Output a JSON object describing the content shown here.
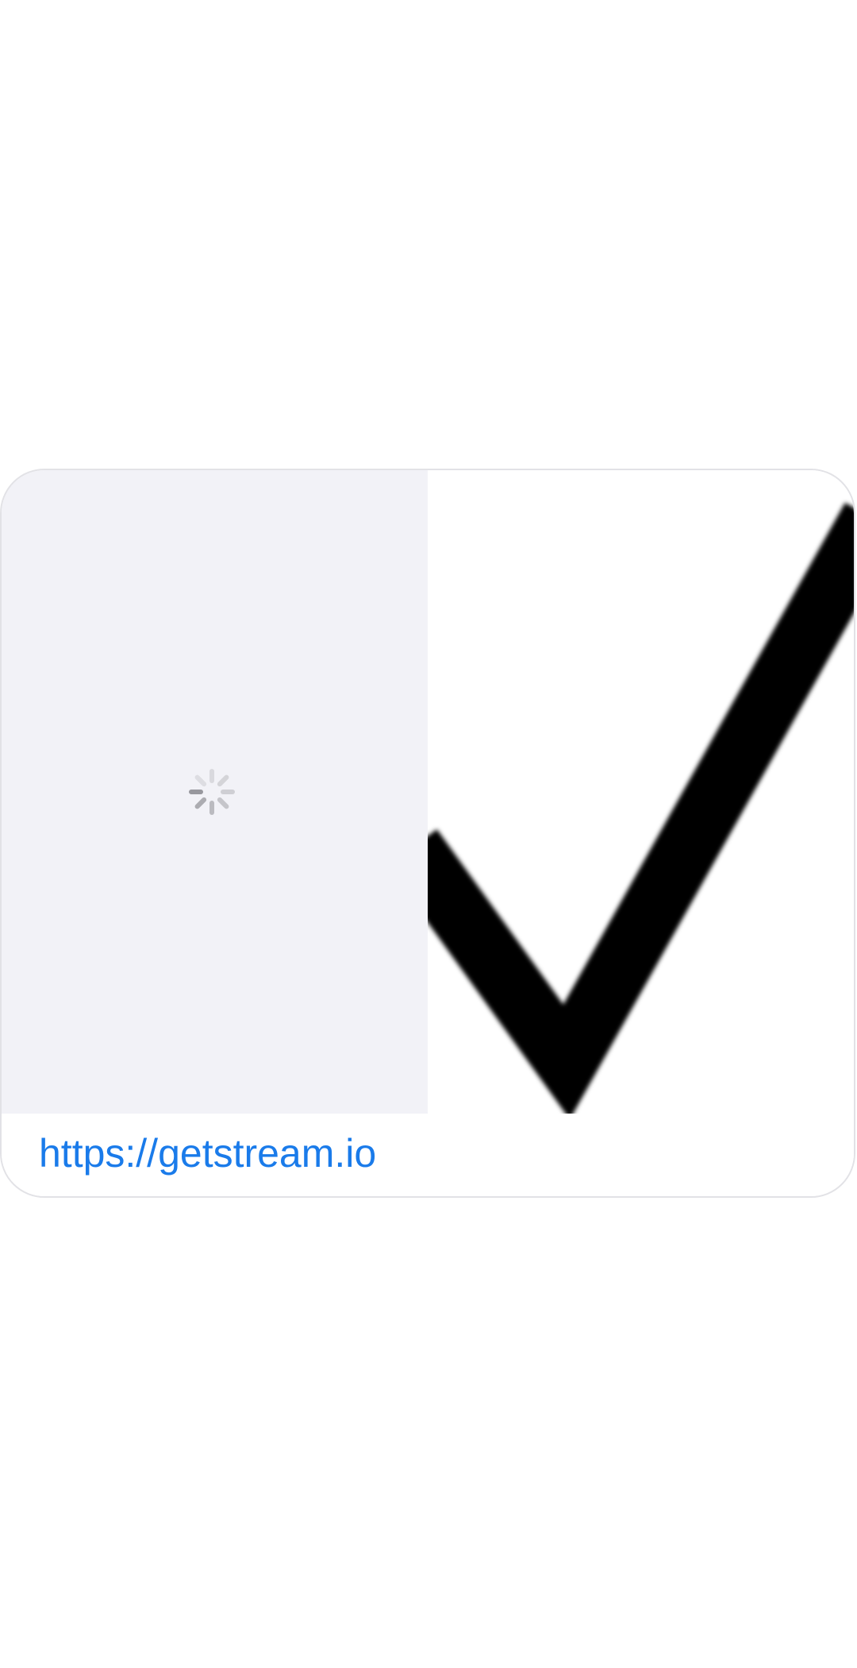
{
  "link_preview": {
    "url": "https://getstream.io",
    "loading_icon": "activity-spinner-icon",
    "image_icon": "checkmark-image"
  },
  "colors": {
    "link": "#1a7bea",
    "loading_bg": "#f2f2f7",
    "border": "#e2e2e6",
    "checkmark": "#000000"
  }
}
